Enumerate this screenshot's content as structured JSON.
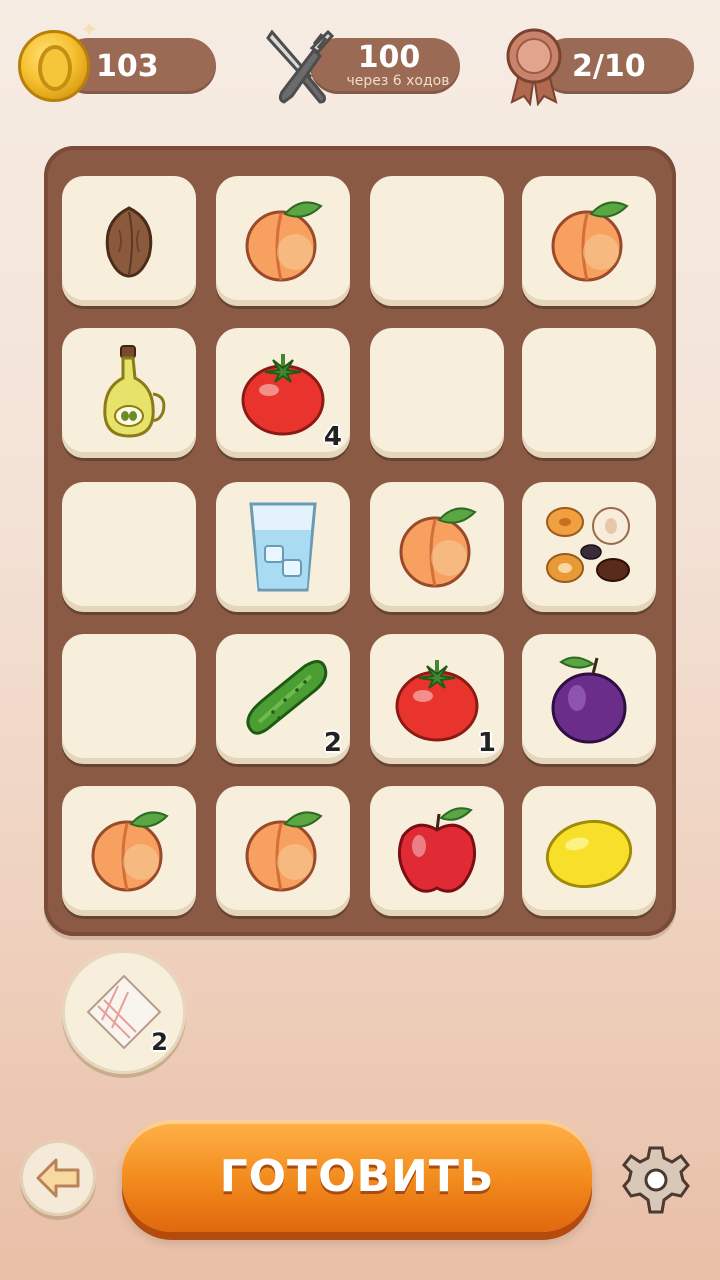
{
  "hud": {
    "coins": "103",
    "score": "100",
    "score_note": "через 6 ходов",
    "progress": "2/10"
  },
  "board": {
    "rows": [
      [
        {
          "item": "nut-icon"
        },
        {
          "item": "peach-icon"
        },
        {
          "item": "empty"
        },
        {
          "item": "peach-icon"
        }
      ],
      [
        {
          "item": "olive-oil-icon"
        },
        {
          "item": "tomato-icon",
          "count": "4"
        },
        {
          "item": "empty"
        },
        {
          "item": "empty"
        }
      ],
      [
        {
          "item": "empty"
        },
        {
          "item": "water-glass-icon"
        },
        {
          "item": "peach-icon"
        },
        {
          "item": "dried-fruits-icon"
        }
      ],
      [
        {
          "item": "empty"
        },
        {
          "item": "cucumber-icon",
          "count": "2"
        },
        {
          "item": "tomato-icon",
          "count": "1"
        },
        {
          "item": "plum-icon"
        }
      ],
      [
        {
          "item": "peach-icon"
        },
        {
          "item": "peach-icon"
        },
        {
          "item": "apple-icon"
        },
        {
          "item": "lemon-icon"
        }
      ]
    ]
  },
  "booster": {
    "icon": "napkin-icon",
    "count": "2"
  },
  "actions": {
    "cook_label": "ГОТОВИТЬ",
    "back_icon": "arrow-left-icon",
    "settings_icon": "gear-icon"
  }
}
